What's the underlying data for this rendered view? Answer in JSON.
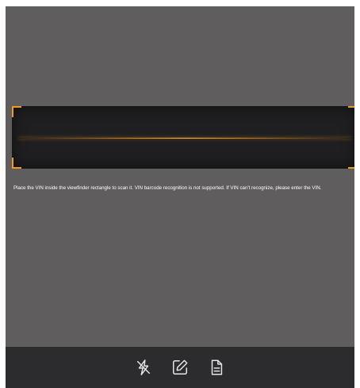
{
  "scanner": {
    "hint_text": "Place the VIN inside the viewfinder rectangle to scan it. VIN barcode recognition is not supported. If VIN can't recognize, please enter the VIN.",
    "accent_color": "#f29a1f"
  },
  "toolbar": {
    "buttons": [
      {
        "icon": "flash-off-icon"
      },
      {
        "icon": "edit-icon"
      },
      {
        "icon": "document-icon"
      }
    ]
  }
}
